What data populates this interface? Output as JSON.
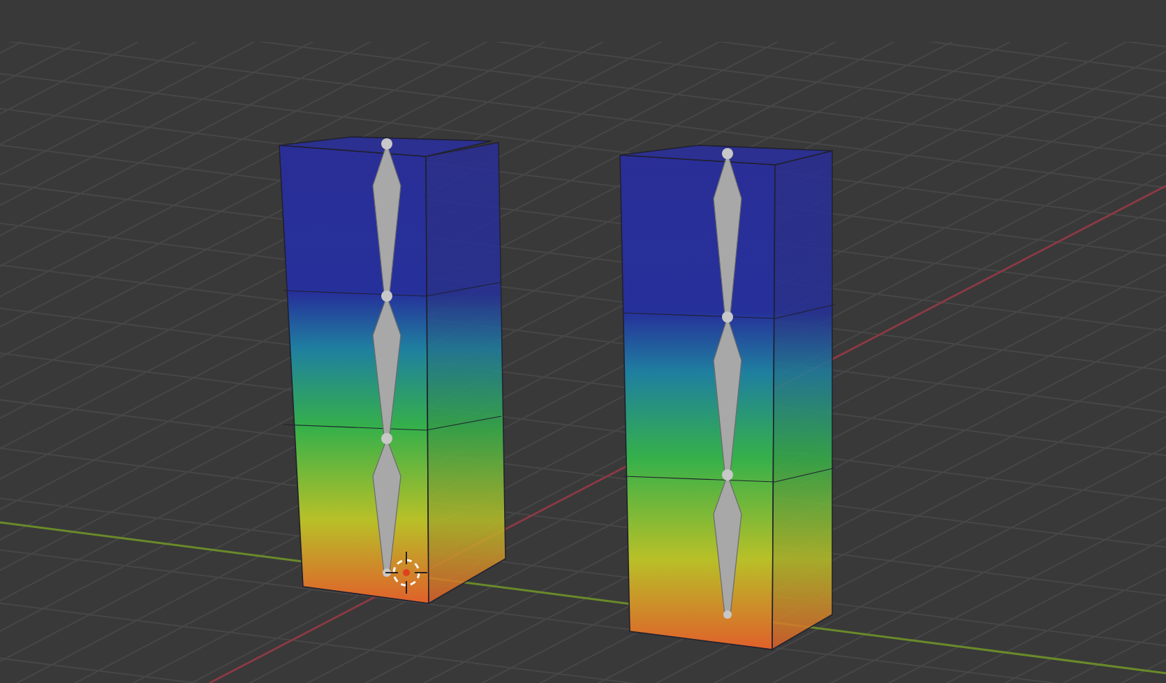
{
  "viewport": {
    "objects": [
      {
        "kind": "weight-painted-mesh"
      },
      {
        "kind": "weight-painted-mesh"
      }
    ],
    "cursor_3d": true
  }
}
